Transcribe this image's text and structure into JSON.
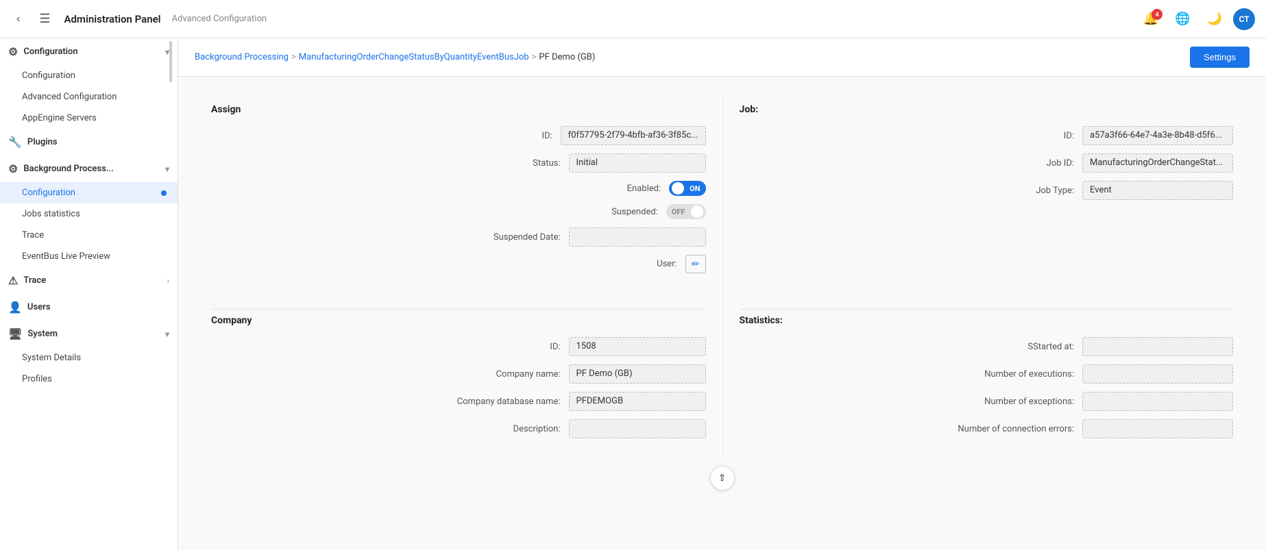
{
  "header": {
    "title": "Administration Panel",
    "subtitle": "Advanced Configuration",
    "notification_badge": "4",
    "avatar_label": "CT"
  },
  "breadcrumb": {
    "items": [
      {
        "label": "Background Processing",
        "link": true
      },
      {
        "label": "ManufacturingOrderChangeStatusByQuantityEventBusJob",
        "link": true
      },
      {
        "label": "PF Demo (GB)",
        "link": false
      }
    ],
    "settings_button": "Settings"
  },
  "sidebar": {
    "sections": [
      {
        "type": "group",
        "label": "Configuration",
        "icon": "⚙",
        "expanded": true,
        "children": [
          {
            "label": "Configuration",
            "active": false
          },
          {
            "label": "Advanced Configuration",
            "active": false
          },
          {
            "label": "AppEngine Servers",
            "active": false
          }
        ]
      },
      {
        "type": "group",
        "label": "Plugins",
        "icon": "🔧",
        "expanded": false,
        "children": []
      },
      {
        "type": "group",
        "label": "Background Process...",
        "icon": "⚙",
        "expanded": true,
        "children": [
          {
            "label": "Configuration",
            "active": true
          },
          {
            "label": "Jobs statistics",
            "active": false
          },
          {
            "label": "Trace",
            "active": false
          },
          {
            "label": "EventBus Live Preview",
            "active": false
          }
        ]
      },
      {
        "type": "group",
        "label": "Trace",
        "icon": "⚠",
        "expanded": false,
        "children": []
      },
      {
        "type": "group",
        "label": "Users",
        "icon": "👤",
        "expanded": false,
        "children": []
      },
      {
        "type": "group",
        "label": "System",
        "icon": "🖥",
        "expanded": true,
        "children": [
          {
            "label": "System Details",
            "active": false
          },
          {
            "label": "Profiles",
            "active": false
          }
        ]
      }
    ]
  },
  "assign_panel": {
    "title": "Assign",
    "fields": [
      {
        "label": "ID:",
        "value": "f0f57795-2f79-4bfb-af36-3f85c..."
      },
      {
        "label": "Status:",
        "value": "Initial"
      },
      {
        "label": "Enabled:",
        "value": "ON",
        "type": "toggle_on"
      },
      {
        "label": "Suspended:",
        "value": "OFF",
        "type": "toggle_off"
      },
      {
        "label": "Suspended Date:",
        "value": ""
      },
      {
        "label": "User:",
        "value": "",
        "type": "edit"
      }
    ]
  },
  "job_panel": {
    "title": "Job:",
    "fields": [
      {
        "label": "ID:",
        "value": "a57a3f66-64e7-4a3e-8b48-d5f6..."
      },
      {
        "label": "Job ID:",
        "value": "ManufacturingOrderChangeStat..."
      },
      {
        "label": "Job Type:",
        "value": "Event"
      }
    ]
  },
  "company_panel": {
    "title": "Company",
    "fields": [
      {
        "label": "ID:",
        "value": "1508"
      },
      {
        "label": "Company name:",
        "value": "PF Demo (GB)"
      },
      {
        "label": "Company database name:",
        "value": "PFDEMOGB"
      },
      {
        "label": "Description:",
        "value": ""
      }
    ]
  },
  "statistics_panel": {
    "title": "Statistics:",
    "fields": [
      {
        "label": "SStarted at:",
        "value": ""
      },
      {
        "label": "Number of executions:",
        "value": ""
      },
      {
        "label": "Number of exceptions:",
        "value": ""
      },
      {
        "label": "Number of connection errors:",
        "value": ""
      }
    ]
  }
}
